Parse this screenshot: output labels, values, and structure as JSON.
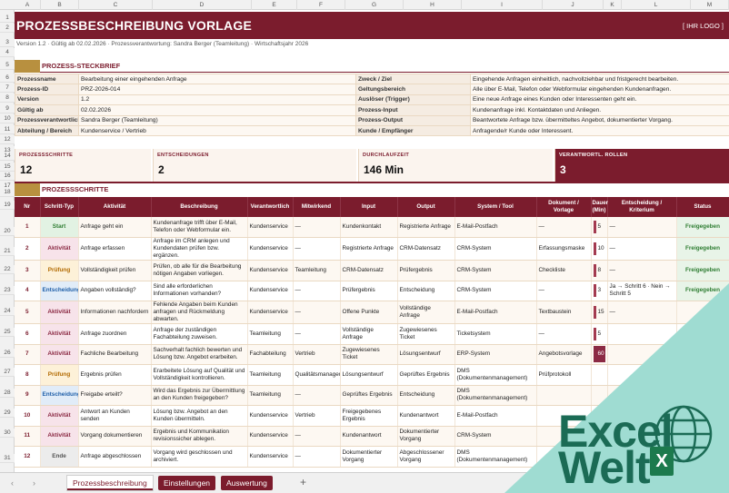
{
  "columns": [
    "A",
    "B",
    "C",
    "D",
    "E",
    "F",
    "G",
    "H",
    "I",
    "J",
    "K",
    "L",
    "M"
  ],
  "rows": [
    "1",
    "2",
    "3",
    "4",
    "5",
    "6",
    "7",
    "8",
    "9",
    "10",
    "11",
    "12",
    "13",
    "14",
    "15",
    "16",
    "17",
    "18",
    "19",
    "20",
    "21",
    "22",
    "23",
    "24",
    "25",
    "26",
    "27",
    "28",
    "29",
    "30",
    "31"
  ],
  "title": "PROZESSBESCHREIBUNG VORLAGE",
  "logo_placeholder": "[ IHR LOGO ]",
  "meta": "Version 1.2  ·  Gültig ab 02.02.2026  ·  Prozessverantwortung: Sandra Berger (Teamleitung)  ·  Wirtschaftsjahr 2026",
  "section_steckbrief": "PROZESS-STECKBRIEF",
  "info_left": [
    [
      "Prozessname",
      "Bearbeitung einer eingehenden Anfrage"
    ],
    [
      "Prozess-ID",
      "PRZ-2026-014"
    ],
    [
      "Version",
      "1.2"
    ],
    [
      "Gültig ab",
      "02.02.2026"
    ],
    [
      "Prozessverantwortliche",
      "Sandra Berger (Teamleitung)"
    ],
    [
      "Abteilung / Bereich",
      "Kundenservice / Vertrieb"
    ]
  ],
  "info_right": [
    [
      "Zweck / Ziel",
      "Eingehende Anfragen einheitlich, nachvollziehbar und fristgerecht bearbeiten."
    ],
    [
      "Geltungsbereich",
      "Alle über E-Mail, Telefon oder Webformular eingehenden Kundenanfragen."
    ],
    [
      "Auslöser (Trigger)",
      "Eine neue Anfrage eines Kunden oder Interessenten geht ein."
    ],
    [
      "Prozess-Input",
      "Kundenanfrage inkl. Kontaktdaten und Anliegen."
    ],
    [
      "Prozess-Output",
      "Beantwortete Anfrage bzw. übermitteltes Angebot, dokumentierter Vorgang."
    ],
    [
      "Kunde / Empfänger",
      "Anfragende/r Kunde oder Interessent."
    ]
  ],
  "kpis": [
    {
      "label": "PROZESSSCHRITTE",
      "value": "12"
    },
    {
      "label": "ENTSCHEIDUNGEN",
      "value": "2"
    },
    {
      "label": "DURCHLAUFZEIT",
      "value": "146 Min"
    },
    {
      "label": "VERANTWORTL. ROLLEN",
      "value": "3"
    }
  ],
  "section_schritte": "PROZESSSCHRITTE",
  "step_headers": [
    "Nr",
    "Schritt-Typ",
    "Aktivität",
    "Beschreibung",
    "Verantwortlich",
    "Mitwirkend",
    "Input",
    "Output",
    "System / Tool",
    "Dokument / Vorlage",
    "Dauer (Min)",
    "Entscheidung / Kriterium",
    "Status"
  ],
  "steps": [
    {
      "nr": "1",
      "typ": "Start",
      "cls": "t-start",
      "akt": "Anfrage geht ein",
      "beschr": "Kundenanfrage trifft über E-Mail, Telefon oder Webformular ein.",
      "ver": "Kundenservice",
      "mit": "—",
      "in": "Kundenkontakt",
      "out": "Registrierte Anfrage",
      "sys": "E-Mail-Postfach",
      "dok": "—",
      "dauer": "5",
      "ent": "—",
      "status": "Freigegeben"
    },
    {
      "nr": "2",
      "typ": "Aktivität",
      "cls": "t-akt",
      "akt": "Anfrage erfassen",
      "beschr": "Anfrage im CRM anlegen und Kundendaten prüfen bzw. ergänzen.",
      "ver": "Kundenservice",
      "mit": "—",
      "in": "Registrierte Anfrage",
      "out": "CRM-Datensatz",
      "sys": "CRM-System",
      "dok": "Erfassungsmaske",
      "dauer": "10",
      "ent": "—",
      "status": "Freigegeben"
    },
    {
      "nr": "3",
      "typ": "Prüfung",
      "cls": "t-pruef",
      "akt": "Vollständigkeit prüfen",
      "beschr": "Prüfen, ob alle für die Bearbeitung nötigen Angaben vorliegen.",
      "ver": "Kundenservice",
      "mit": "Teamleitung",
      "in": "CRM-Datensatz",
      "out": "Prüfergebnis",
      "sys": "CRM-System",
      "dok": "Checkliste",
      "dauer": "8",
      "ent": "—",
      "status": "Freigegeben"
    },
    {
      "nr": "4",
      "typ": "Entscheidung",
      "cls": "t-ent",
      "akt": "Angaben vollständig?",
      "beschr": "Sind alle erforderlichen Informationen vorhanden?",
      "ver": "Kundenservice",
      "mit": "—",
      "in": "Prüfergebnis",
      "out": "Entscheidung",
      "sys": "CRM-System",
      "dok": "—",
      "dauer": "3",
      "ent": "Ja → Schritt 6 · Nein → Schritt 5",
      "status": "Freigegeben"
    },
    {
      "nr": "5",
      "typ": "Aktivität",
      "cls": "t-akt",
      "akt": "Informationen nachfordern",
      "beschr": "Fehlende Angaben beim Kunden anfragen und Rückmeldung abwarten.",
      "ver": "Kundenservice",
      "mit": "—",
      "in": "Offene Punkte",
      "out": "Vollständige Anfrage",
      "sys": "E-Mail-Postfach",
      "dok": "Textbaustein",
      "dauer": "15",
      "ent": "—",
      "status": ""
    },
    {
      "nr": "6",
      "typ": "Aktivität",
      "cls": "t-akt",
      "akt": "Anfrage zuordnen",
      "beschr": "Anfrage der zuständigen Fachabteilung zuweisen.",
      "ver": "Teamleitung",
      "mit": "—",
      "in": "Vollständige Anfrage",
      "out": "Zugewiesenes Ticket",
      "sys": "Ticketsystem",
      "dok": "—",
      "dauer": "5",
      "ent": "",
      "status": ""
    },
    {
      "nr": "7",
      "typ": "Aktivität",
      "cls": "t-akt",
      "akt": "Fachliche Bearbeitung",
      "beschr": "Sachverhalt fachlich bewerten und Lösung bzw. Angebot erarbeiten.",
      "ver": "Fachabteilung",
      "mit": "Vertrieb",
      "in": "Zugewiesenes Ticket",
      "out": "Lösungsentwurf",
      "sys": "ERP-System",
      "dok": "Angebotsvorlage",
      "dauer": "60",
      "ent": "",
      "status": ""
    },
    {
      "nr": "8",
      "typ": "Prüfung",
      "cls": "t-pruef",
      "akt": "Ergebnis prüfen",
      "beschr": "Erarbeitete Lösung auf Qualität und Vollständigkeit kontrollieren.",
      "ver": "Teamleitung",
      "mit": "Qualitätsmanagement",
      "in": "Lösungsentwurf",
      "out": "Geprüftes Ergebnis",
      "sys": "DMS (Dokumentenmanagement)",
      "dok": "Prüfprotokoll",
      "dauer": "",
      "ent": "",
      "status": ""
    },
    {
      "nr": "9",
      "typ": "Entscheidung",
      "cls": "t-ent",
      "akt": "Freigabe erteilt?",
      "beschr": "Wird das Ergebnis zur Übermittlung an den Kunden freigegeben?",
      "ver": "Teamleitung",
      "mit": "—",
      "in": "Geprüftes Ergebnis",
      "out": "Entscheidung",
      "sys": "DMS (Dokumentenmanagement)",
      "dok": "",
      "dauer": "",
      "ent": "",
      "status": ""
    },
    {
      "nr": "10",
      "typ": "Aktivität",
      "cls": "t-akt",
      "akt": "Antwort an Kunden senden",
      "beschr": "Lösung bzw. Angebot an den Kunden übermitteln.",
      "ver": "Kundenservice",
      "mit": "Vertrieb",
      "in": "Freigegebenes Ergebnis",
      "out": "Kundenantwort",
      "sys": "E-Mail-Postfach",
      "dok": "",
      "dauer": "",
      "ent": "",
      "status": ""
    },
    {
      "nr": "11",
      "typ": "Aktivität",
      "cls": "t-akt",
      "akt": "Vorgang dokumentieren",
      "beschr": "Ergebnis und Kommunikation revisionssicher ablegen.",
      "ver": "Kundenservice",
      "mit": "—",
      "in": "Kundenantwort",
      "out": "Dokumentierter Vorgang",
      "sys": "CRM-System",
      "dok": "",
      "dauer": "",
      "ent": "",
      "status": ""
    },
    {
      "nr": "12",
      "typ": "Ende",
      "cls": "t-ende",
      "akt": "Anfrage abgeschlossen",
      "beschr": "Vorgang wird geschlossen und archiviert.",
      "ver": "Kundenservice",
      "mit": "—",
      "in": "Dokumentierter Vorgang",
      "out": "Abgeschlossener Vorgang",
      "sys": "DMS (Dokumentenmanagement)",
      "dok": "",
      "dauer": "",
      "ent": "",
      "status": ""
    }
  ],
  "sheet_tabs": [
    "Prozessbeschreibung",
    "Einstellungen",
    "Auswertung"
  ],
  "add_tab": "+",
  "nav_prev": "‹",
  "nav_next": "›",
  "watermark": {
    "line1": "Excel",
    "line2": "Welt",
    "badge": "X"
  },
  "colors": {
    "accent": "#7b1c2d",
    "gold": "#b8903f",
    "watermark_bg": "#9fdcd2",
    "watermark_text": "#1b6b55"
  }
}
